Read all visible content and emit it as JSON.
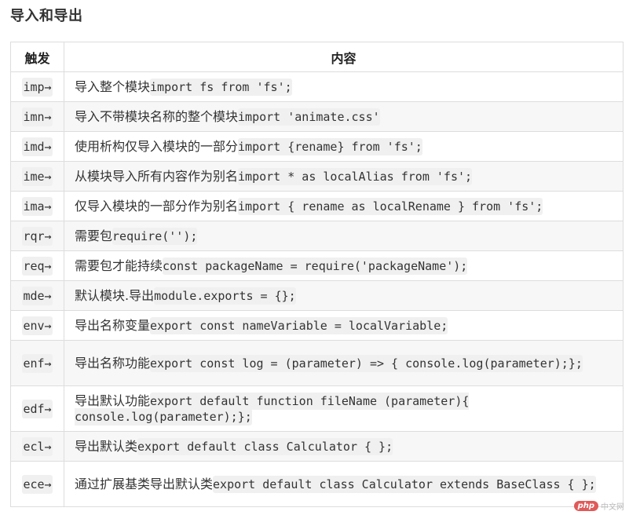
{
  "section_title": "导入和导出",
  "table": {
    "headers": [
      "触发",
      "内容"
    ],
    "rows": [
      {
        "trigger": "imp→",
        "desc": "导入整个模块",
        "code": "import fs from 'fs';"
      },
      {
        "trigger": "imn→",
        "desc": "导入不带模块名称的整个模块",
        "code": "import 'animate.css'"
      },
      {
        "trigger": "imd→",
        "desc": "使用析构仅导入模块的一部分",
        "code": "import {rename} from 'fs';"
      },
      {
        "trigger": "ime→",
        "desc": "从模块导入所有内容作为别名",
        "code": "import * as localAlias from 'fs';"
      },
      {
        "trigger": "ima→",
        "desc": "仅导入模块的一部分作为别名",
        "code": "import { rename as localRename } from 'fs';"
      },
      {
        "trigger": "rqr→",
        "desc": "需要包",
        "code": "require('');"
      },
      {
        "trigger": "req→",
        "desc": "需要包才能持续",
        "code": "const packageName = require('packageName');"
      },
      {
        "trigger": "mde→",
        "desc": "默认模块.导出",
        "code": "module.exports = {};"
      },
      {
        "trigger": "env→",
        "desc": "导出名称变量",
        "code": "export const nameVariable = localVariable;"
      },
      {
        "trigger": "enf→",
        "desc": "导出名称功能",
        "code": "export const log = (parameter) => { console.log(parameter);};"
      },
      {
        "trigger": "edf→",
        "desc": "导出默认功能",
        "code": "export default function fileName (parameter){ console.log(parameter);};"
      },
      {
        "trigger": "ecl→",
        "desc": "导出默认类",
        "code": "export default class Calculator { };"
      },
      {
        "trigger": "ece→",
        "desc": "通过扩展基类导出默认类",
        "code": "export default class Calculator extends BaseClass { };"
      }
    ]
  },
  "watermark": {
    "logo": "php",
    "text": "中文网"
  }
}
